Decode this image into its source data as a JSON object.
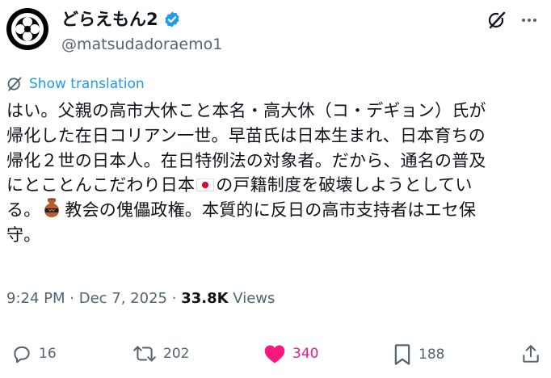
{
  "user": {
    "display_name": "どらえもん2",
    "handle": "@matsudadoraemo1"
  },
  "translate": {
    "label": "Show translation"
  },
  "post": {
    "lines": [
      "はい。父親の高市大休こと本名・高大休（コ・デギョン）氏が",
      "帰化した在日コリアン一世。早苗氏は日本生まれ、日本育ちの",
      "帰化２世の日本人。在日特例法の対象者。だから、通名の普及",
      "にとことんこだわり日本",
      "の戸籍制度を破壊しようとしてい",
      "る。",
      "教会の傀儡政権。本質的に反日の高市支持者はエセ保",
      "守。"
    ]
  },
  "meta": {
    "time": "9:24 PM",
    "date": "Dec 7, 2025",
    "views_count": "33.8K",
    "views_label": "Views"
  },
  "actions": {
    "replies": "16",
    "reposts": "202",
    "likes": "340",
    "bookmarks": "188"
  },
  "colors": {
    "accent": "#1d9bf0",
    "like": "#f91880",
    "muted": "#536471",
    "text": "#0f1419"
  },
  "icons": [
    "verified-badge-icon",
    "grok-icon",
    "more-icon",
    "translate-icon",
    "reply-icon",
    "repost-icon",
    "like-heart-icon",
    "bookmark-icon",
    "share-icon",
    "japan-flag-emoji",
    "vase-emoji"
  ]
}
